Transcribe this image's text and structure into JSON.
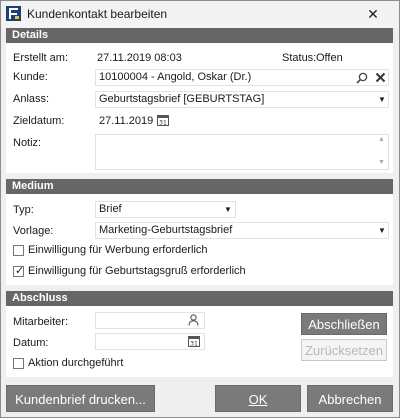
{
  "window": {
    "title": "Kundenkontakt bearbeiten",
    "close_glyph": "✕"
  },
  "details": {
    "header": "Details",
    "erstellt_label": "Erstellt am:",
    "erstellt_value": "27.11.2019 08:03",
    "status_label": "Status:",
    "status_value": "Offen",
    "kunde_label": "Kunde:",
    "kunde_value": "10100004 - Angold, Oskar (Dr.)",
    "anlass_label": "Anlass:",
    "anlass_value": "Geburtstagsbrief [GEBURTSTAG]",
    "zieldatum_label": "Zieldatum:",
    "zieldatum_value": "27.11.2019",
    "notiz_label": "Notiz:",
    "notiz_value": ""
  },
  "medium": {
    "header": "Medium",
    "typ_label": "Typ:",
    "typ_value": "Brief",
    "vorlage_label": "Vorlage:",
    "vorlage_value": "Marketing-Geburtstagsbrief",
    "werbung_label": "Einwilligung für Werbung erforderlich",
    "werbung_checked": false,
    "gruss_label": "Einwilligung für Geburtstagsgruß erforderlich",
    "gruss_checked": true
  },
  "abschluss": {
    "header": "Abschluss",
    "mitarbeiter_label": "Mitarbeiter:",
    "mitarbeiter_value": "",
    "datum_label": "Datum:",
    "datum_value": "",
    "aktion_label": "Aktion durchgeführt",
    "aktion_checked": false,
    "abschliessen_label": "Abschließen",
    "zuruecksetzen_label": "Zurücksetzen"
  },
  "footer": {
    "print_label": "Kundenbrief drucken...",
    "ok_label": "OK",
    "cancel_label": "Abbrechen"
  },
  "colors": {
    "section_header": "#666666",
    "button": "#7a7a7a",
    "panel": "#ffffff",
    "window_bg": "#efefef"
  },
  "icons": [
    "app-icon",
    "close-icon",
    "search-icon",
    "clear-icon",
    "dropdown-arrow-icon",
    "calendar-icon",
    "user-icon",
    "checkmark-icon"
  ]
}
